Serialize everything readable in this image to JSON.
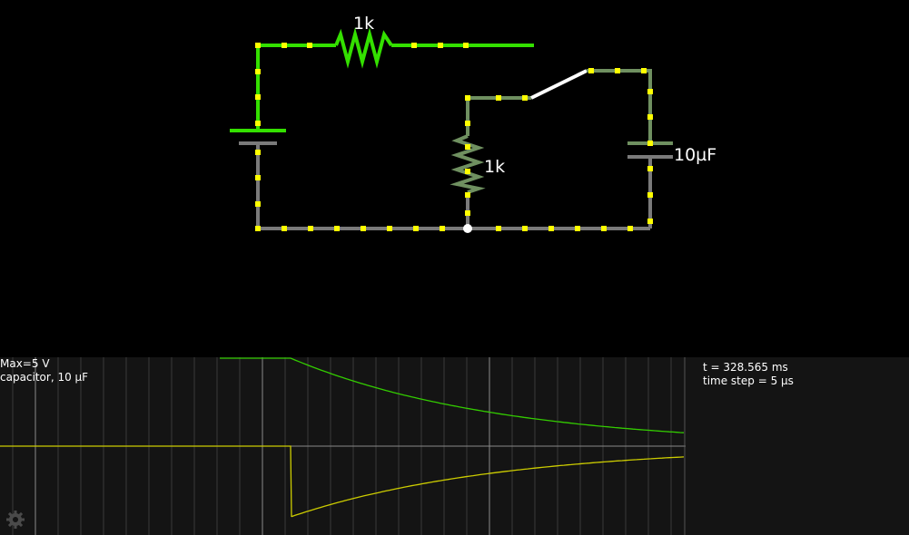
{
  "circuit": {
    "top_resistor_label": "1k",
    "mid_resistor_label": "1k",
    "capacitor_label": "10µF"
  },
  "scope": {
    "max_label": "Max=5 V",
    "probe_label": "capacitor, 10 µF",
    "time_label": "t = 328.565 ms",
    "timestep_label": "time step = 5 µs"
  },
  "colors": {
    "wire_active": "#34e000",
    "wire_idle": "#7a7a7a",
    "wire_mid": "#6f9060",
    "current_dot": "#ffff00",
    "voltage_trace": "#33cc00",
    "current_trace": "#cccc00"
  },
  "icons": {
    "settings": "gear-icon"
  }
}
